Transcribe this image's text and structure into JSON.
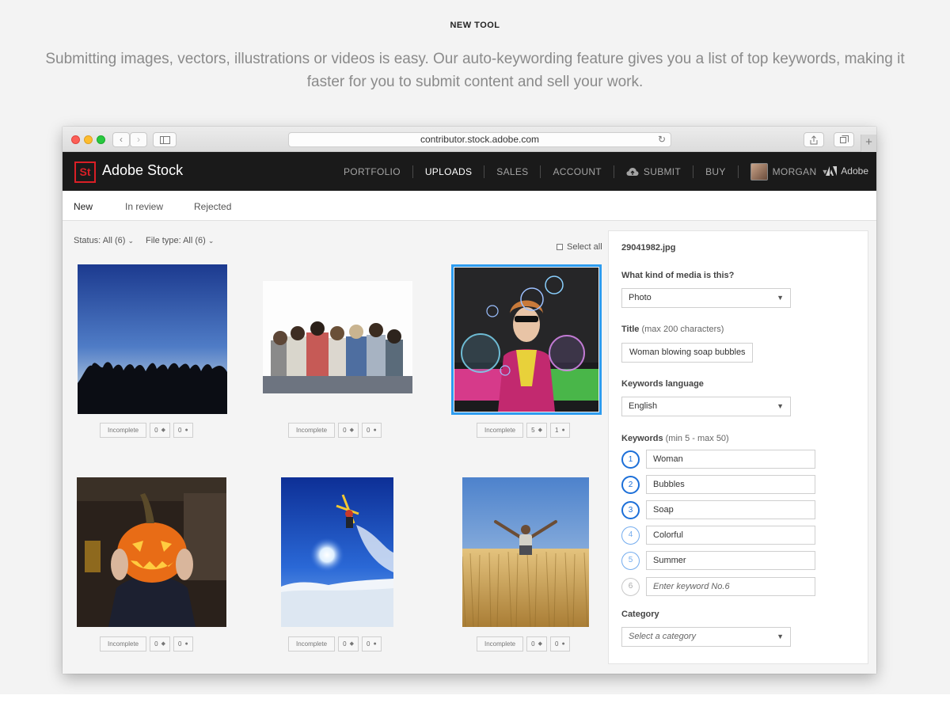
{
  "hero": {
    "kicker": "NEW TOOL",
    "text": "Submitting images, vectors, illustrations or videos is easy. Our auto-keywording feature gives you a list of top keywords, making it faster for you to submit content and sell your work."
  },
  "browser": {
    "url": "contributor.stock.adobe.com",
    "new_tab": "+"
  },
  "nav": {
    "logo": "St",
    "brand": "Adobe Stock",
    "items": [
      "PORTFOLIO",
      "UPLOADS",
      "SALES",
      "ACCOUNT",
      "SUBMIT",
      "BUY",
      "MORGAN"
    ],
    "adobe": "Adobe"
  },
  "tabs": [
    "New",
    "In review",
    "Rejected"
  ],
  "filters": {
    "status": "Status: All (6)",
    "file_type": "File type: All (6)",
    "select_all": "Select all"
  },
  "uploads": [
    {
      "status": "Incomplete",
      "keywords": "0",
      "people": "0"
    },
    {
      "status": "Incomplete",
      "keywords": "0",
      "people": "0"
    },
    {
      "status": "Incomplete",
      "keywords": "5",
      "people": "1",
      "selected": true
    },
    {
      "status": "Incomplete",
      "keywords": "0",
      "people": "0"
    },
    {
      "status": "Incomplete",
      "keywords": "0",
      "people": "0"
    },
    {
      "status": "Incomplete",
      "keywords": "0",
      "people": "0"
    }
  ],
  "panel": {
    "filename": "29041982.jpg",
    "media_label": "What kind of media is this?",
    "media_value": "Photo",
    "title_label": "Title",
    "title_hint": "(max 200 characters)",
    "title_value": "Woman blowing soap bubbles",
    "lang_label": "Keywords language",
    "lang_value": "English",
    "keywords_label": "Keywords",
    "keywords_hint": "(min 5 - max 50)",
    "keywords": [
      {
        "n": "1",
        "value": "Woman"
      },
      {
        "n": "2",
        "value": "Bubbles"
      },
      {
        "n": "3",
        "value": "Soap"
      },
      {
        "n": "4",
        "value": "Colorful"
      },
      {
        "n": "5",
        "value": "Summer"
      }
    ],
    "keyword_next": {
      "n": "6",
      "placeholder": "Enter keyword No.6"
    },
    "category_label": "Category",
    "category_placeholder": "Select a category"
  },
  "colors": {
    "accent": "#1c6fd8",
    "selection": "#2d9cef",
    "brand_red": "#da1f26",
    "nav_bg": "#1a1a1a"
  }
}
